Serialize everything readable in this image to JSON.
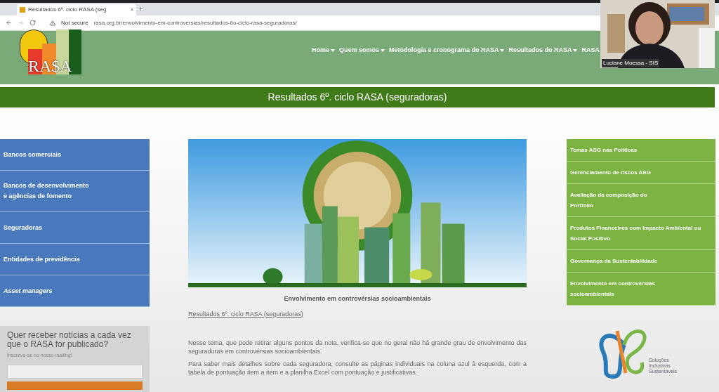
{
  "browser": {
    "tab_title": "Resultados 6º. ciclo RASA (seg",
    "tab_close": "×",
    "new_tab": "+",
    "security": "Not secure",
    "url": "rasa.org.br/envolvimento-em-controversias/resultados-6o-ciclo-rasa-seguradoras/"
  },
  "site": {
    "logo_text": "RA$A",
    "nav": [
      {
        "label": "Home",
        "dropdown": true
      },
      {
        "label": "Quem somos",
        "dropdown": true
      },
      {
        "label": "Metodologia e cronograma do RASA",
        "dropdown": true
      },
      {
        "label": "Resultados do RASA",
        "dropdown": true
      },
      {
        "label": "RASA",
        "dropdown": false
      }
    ],
    "page_title": "Resultados 6º. ciclo RASA (seguradoras)"
  },
  "left_menu": [
    {
      "label": "Bancos comerciais",
      "italic": false
    },
    {
      "label": "Bancos de desenvolvimento\ne agências de fomento",
      "italic": false
    },
    {
      "label": "Seguradoras",
      "italic": false
    },
    {
      "label": "Entidades de previdência",
      "italic": false
    },
    {
      "label": "Asset managers",
      "italic": true
    }
  ],
  "newsletter": {
    "heading": "Quer receber notícias a cada vez que o RASA for publicado?",
    "hint": "Inscreva-se no nosso *mailing*!"
  },
  "main": {
    "caption": "Envolvimento em controvérsias socioambientais",
    "link": "Resultados 6º. ciclo RASA (seguradoras)",
    "paragraphs": [
      "Nesse tema, que pode retirar alguns pontos da nota, verifica-se que no geral não há grande grau de envolvimento das seguradoras em controvérsias socioambientais.",
      "Para saber mais detalhes sobre cada seguradora, consulte as páginas individuais na coluna azul à esquerda, com a tabela de pontuação item a item e a planilha Excel com pontuação e justificativas."
    ]
  },
  "right_menu": [
    "Temas ASG nas Políticas",
    "Gerenciamento de riscos ASG",
    "Avaliação da composição do\nPortfólio",
    "Produtos Financeiros com Impacto Ambiental ou Social Positivo",
    "Governança da Sustentabilidade",
    "Envolvimento em controvérsias\nsocioambientais"
  ],
  "partner_logo": {
    "lines": [
      "Soluções",
      "Inclusivas",
      "Sustentáveis"
    ]
  },
  "video": {
    "speaker": "Luciane Moessa - SIS"
  }
}
